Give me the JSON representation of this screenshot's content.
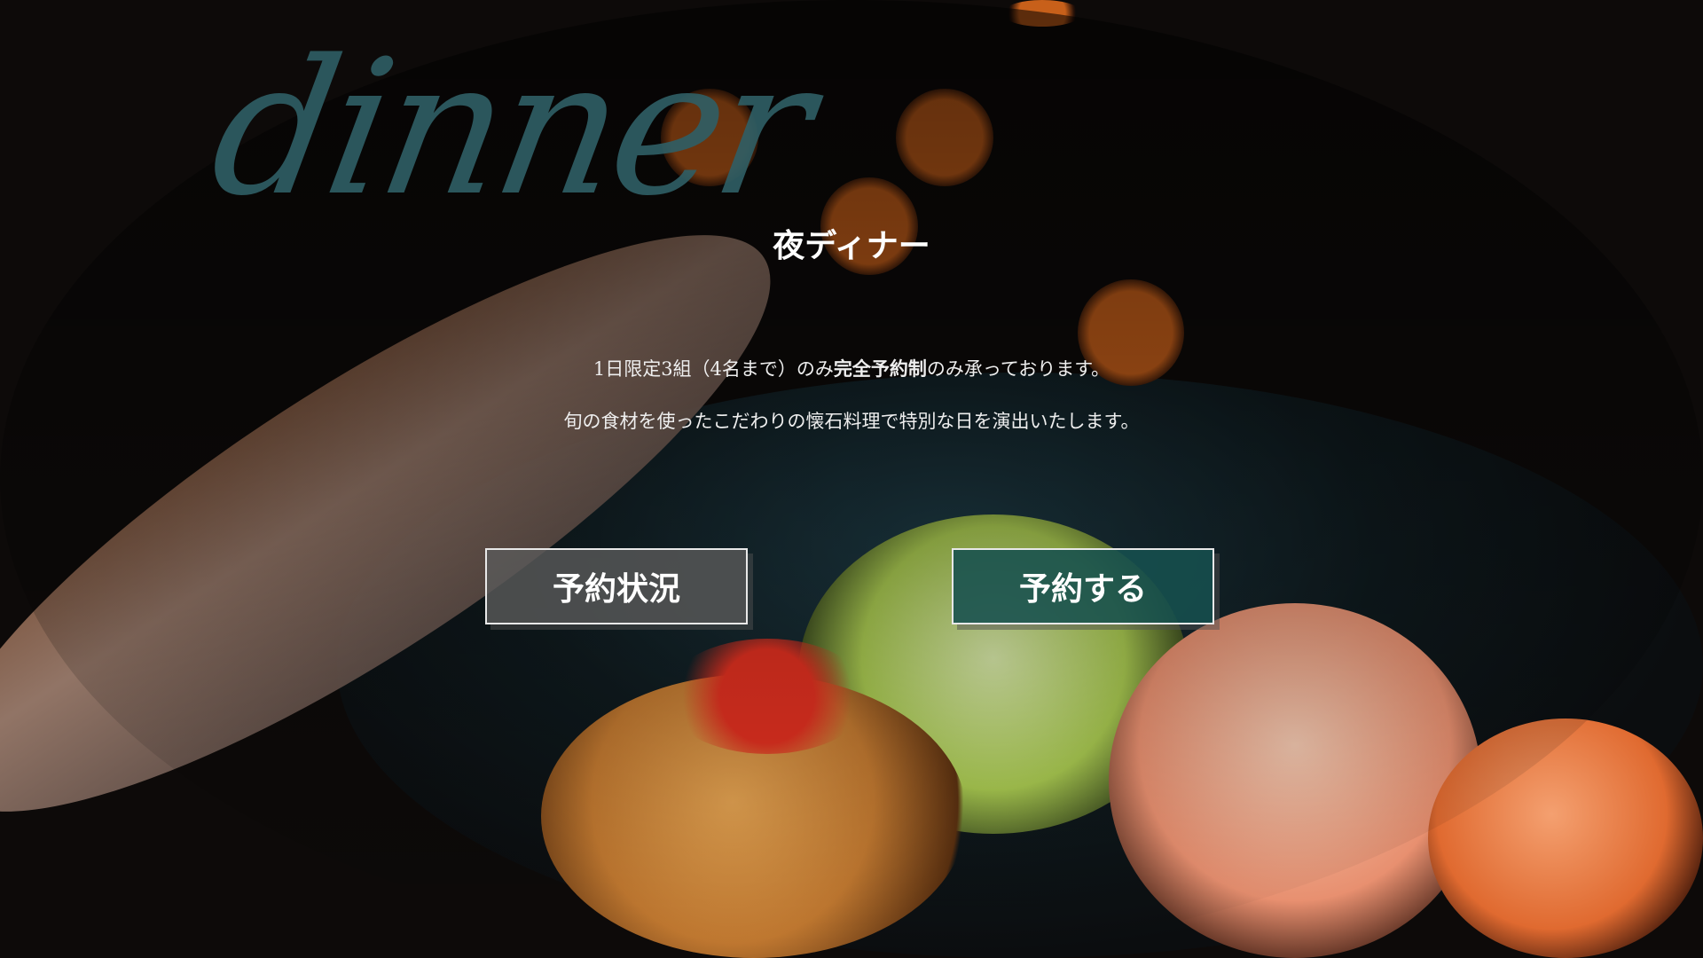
{
  "hero": {
    "script_heading": "dinner",
    "title": "夜ディナー",
    "line1_prefix": "1日限定3組（4名まで）のみ",
    "line1_emphasis": "完全予約制",
    "line1_suffix": "のみ承っております。",
    "line2": "旬の食材を使ったこだわりの懐石料理で特別な日を演出いたします。"
  },
  "buttons": {
    "status_label": "予約状況",
    "reserve_label": "予約する"
  },
  "colors": {
    "accent": "#16504e",
    "script": "#2f5f66"
  }
}
